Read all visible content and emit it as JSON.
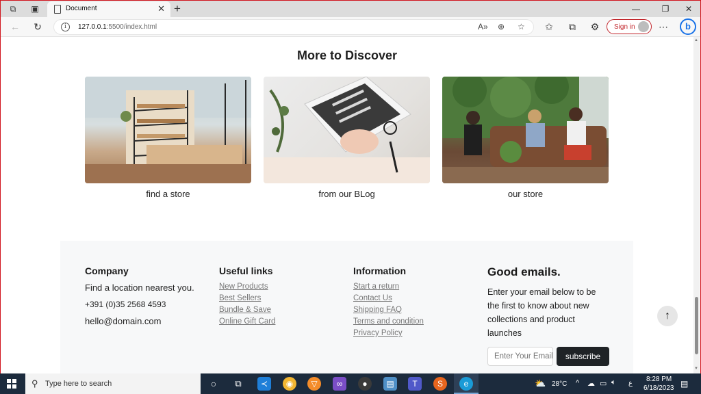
{
  "browser": {
    "tab_title": "Document",
    "url_host": "127.0.0.1",
    "url_rest": ":5500/index.html",
    "signin_label": "Sign in"
  },
  "page": {
    "section_title": "More to Discover",
    "cards": [
      {
        "caption": "find a store"
      },
      {
        "caption": "from our BLog"
      },
      {
        "caption": "our store"
      }
    ]
  },
  "footer": {
    "company": {
      "heading": "Company",
      "tagline": "Find a location nearest you.",
      "phone": "+391 (0)35 2568 4593",
      "email": "hello@domain.com"
    },
    "useful_links": {
      "heading": "Useful links",
      "links": [
        "New Products",
        "Best Sellers",
        "Bundle & Save",
        "Online Gift Card"
      ]
    },
    "information": {
      "heading": "Information",
      "links": [
        "Start a return",
        "Contact Us",
        "Shipping FAQ",
        "Terms and condition",
        "Privacy Policy"
      ]
    },
    "newsletter": {
      "heading": "Good emails.",
      "description": "Enter your email below to be the first to know about new collections and product launches",
      "input_placeholder": "Enter Your Email",
      "button_label": "subscribe"
    }
  },
  "taskbar": {
    "search_placeholder": "Type here to search",
    "weather": "28°C",
    "time": "8:28 PM",
    "date": "6/18/2023",
    "lang": "ع"
  }
}
